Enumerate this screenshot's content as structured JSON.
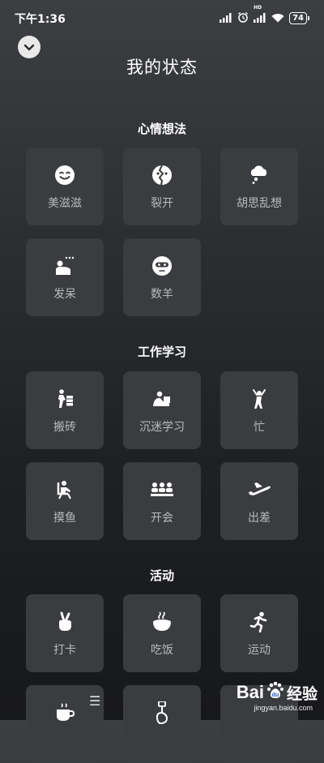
{
  "status_bar": {
    "time": "下午1:36",
    "network_badge": "HD",
    "battery_level": "74",
    "icons": [
      "signal-icon",
      "alarm-icon",
      "signal-bars-icon",
      "wifi-icon",
      "battery-icon"
    ]
  },
  "header": {
    "title": "我的状态",
    "collapse_icon": "chevron-down-icon"
  },
  "sections": [
    {
      "title": "心情想法",
      "items": [
        {
          "label": "美滋滋",
          "icon": "smile-face-icon"
        },
        {
          "label": "裂开",
          "icon": "cracked-face-icon"
        },
        {
          "label": "胡思乱想",
          "icon": "thought-cloud-icon"
        },
        {
          "label": "发呆",
          "icon": "daze-icon"
        },
        {
          "label": "数羊",
          "icon": "sleep-mask-icon"
        }
      ]
    },
    {
      "title": "工作学习",
      "items": [
        {
          "label": "搬砖",
          "icon": "brick-carrier-icon"
        },
        {
          "label": "沉迷学习",
          "icon": "studying-icon"
        },
        {
          "label": "忙",
          "icon": "busy-person-icon"
        },
        {
          "label": "摸鱼",
          "icon": "slacking-chair-icon"
        },
        {
          "label": "开会",
          "icon": "meeting-icon"
        },
        {
          "label": "出差",
          "icon": "airplane-icon"
        }
      ]
    },
    {
      "title": "活动",
      "items": [
        {
          "label": "打卡",
          "icon": "peace-hand-icon"
        },
        {
          "label": "吃饭",
          "icon": "food-bowl-icon"
        },
        {
          "label": "运动",
          "icon": "running-icon"
        },
        {
          "label": "",
          "icon": "coffee-cup-icon"
        },
        {
          "label": "",
          "icon": "guitar-icon"
        }
      ]
    }
  ],
  "overlay": {
    "menu_glyph": "☰"
  },
  "watermark": {
    "brand_left": "Bai",
    "brand_right": "经验",
    "url": "jingyan.baidu.com"
  }
}
